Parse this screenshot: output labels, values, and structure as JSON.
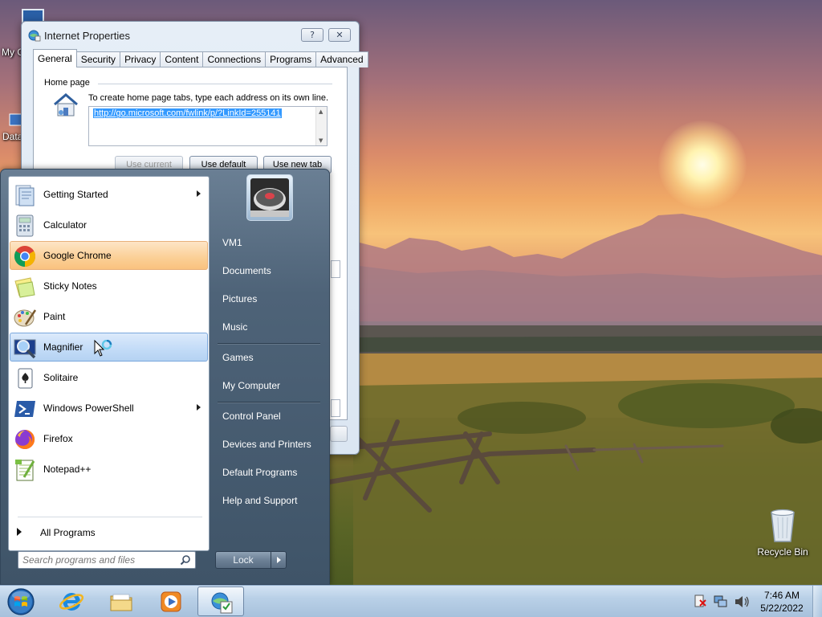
{
  "desktop": {
    "icons": [
      {
        "label": "My C"
      },
      {
        "label": "Data"
      },
      {
        "label": "Recycle Bin"
      }
    ]
  },
  "internet_properties": {
    "title": "Internet Properties",
    "help_symbol": "?",
    "close_symbol": "✕",
    "tabs": [
      "General",
      "Security",
      "Privacy",
      "Content",
      "Connections",
      "Programs",
      "Advanced"
    ],
    "active_tab": "General",
    "home_page": {
      "group_label": "Home page",
      "description": "To create home page tabs, type each address on its own line.",
      "url": "http://go.microsoft.com/fwlink/p/?LinkId=255141",
      "buttons": {
        "use_current": "Use current",
        "use_default": "Use default",
        "use_new_tab": "Use new tab"
      }
    }
  },
  "start_menu": {
    "programs": [
      {
        "label": "Getting Started",
        "icon": "getting-started-icon",
        "submenu": true
      },
      {
        "label": "Calculator",
        "icon": "calculator-icon",
        "submenu": false
      },
      {
        "label": "Google Chrome",
        "icon": "chrome-icon",
        "submenu": false,
        "highlight": "orange"
      },
      {
        "label": "Sticky Notes",
        "icon": "sticky-notes-icon",
        "submenu": false
      },
      {
        "label": "Paint",
        "icon": "paint-icon",
        "submenu": false
      },
      {
        "label": "Magnifier",
        "icon": "magnifier-icon",
        "submenu": false,
        "highlight": "blue"
      },
      {
        "label": "Solitaire",
        "icon": "solitaire-icon",
        "submenu": false
      },
      {
        "label": "Windows PowerShell",
        "icon": "powershell-icon",
        "submenu": true
      },
      {
        "label": "Firefox",
        "icon": "firefox-icon",
        "submenu": false
      },
      {
        "label": "Notepad++",
        "icon": "notepadpp-icon",
        "submenu": false
      }
    ],
    "all_programs": "All Programs",
    "search_placeholder": "Search programs and files",
    "right_items": [
      {
        "label": "VM1"
      },
      {
        "label": "Documents"
      },
      {
        "label": "Pictures"
      },
      {
        "label": "Music"
      },
      {
        "label": "Games"
      },
      {
        "label": "My Computer"
      },
      {
        "label": "Control Panel"
      },
      {
        "label": "Devices and Printers"
      },
      {
        "label": "Default Programs"
      },
      {
        "label": "Help and Support"
      }
    ],
    "lock_label": "Lock"
  },
  "taskbar": {
    "pinned": [
      {
        "icon": "internet-explorer-icon"
      },
      {
        "icon": "explorer-folder-icon"
      },
      {
        "icon": "media-player-icon"
      },
      {
        "icon": "internet-options-icon",
        "active": true
      }
    ],
    "clock": {
      "time": "7:46 AM",
      "date": "5/22/2022"
    }
  },
  "colors": {
    "taskbar": "#b9d0e7",
    "start_menu": "#4e6378",
    "highlight_orange": "#fbcf95",
    "highlight_blue": "#c2dbf7",
    "url_selection": "#3399ff"
  }
}
